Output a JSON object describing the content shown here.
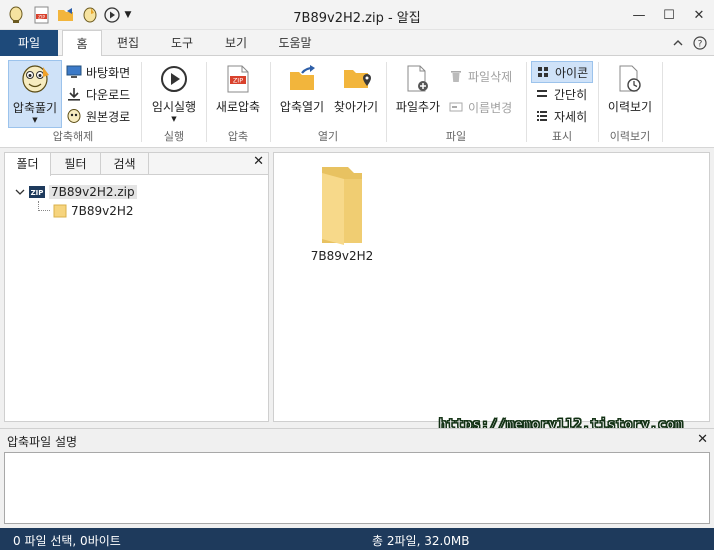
{
  "window": {
    "title": "7B89v2H2.zip - 알집"
  },
  "quick_access": [
    {
      "name": "alzip-logo-icon"
    },
    {
      "name": "zip-file-icon"
    },
    {
      "name": "open-folder-icon"
    },
    {
      "name": "extract-wand-icon"
    },
    {
      "name": "play-icon"
    },
    {
      "name": "dropdown-arrow-icon"
    }
  ],
  "window_controls": {
    "minimize": "—",
    "maximize": "☐",
    "close": "✕"
  },
  "tabs": [
    {
      "label": "파일"
    },
    {
      "label": "홈"
    },
    {
      "label": "편집"
    },
    {
      "label": "도구"
    },
    {
      "label": "보기"
    },
    {
      "label": "도움말"
    }
  ],
  "ribbon": {
    "extract": {
      "label": "압축풀기",
      "desktop": "바탕화면",
      "download": "다운로드",
      "original": "원본경로",
      "group": "압축해제"
    },
    "run": {
      "label": "임시실행",
      "group": "실행"
    },
    "compress": {
      "label": "새로압축",
      "group": "압축"
    },
    "open": {
      "open_label": "압축열기",
      "find_label": "찾아가기",
      "group": "열기"
    },
    "file": {
      "add_label": "파일추가",
      "delete_label": "파일삭제",
      "rename_label": "이름변경",
      "group": "파일"
    },
    "view": {
      "icon_label": "아이콘",
      "simple_label": "간단히",
      "detail_label": "자세히",
      "group": "표시"
    },
    "history": {
      "label": "이력보기",
      "group": "이력보기"
    }
  },
  "left_panel": {
    "tabs": [
      {
        "label": "폴더"
      },
      {
        "label": "필터"
      },
      {
        "label": "검색"
      }
    ],
    "close": "✕",
    "tree": {
      "root": "7B89v2H2.zip",
      "child": "7B89v2H2"
    }
  },
  "main": {
    "items": [
      {
        "name": "7B89v2H2"
      }
    ],
    "watermark": "https://memory112.tistory.com"
  },
  "description": {
    "title": "압축파일 설명",
    "close": "✕"
  },
  "status": {
    "left": "0 파일 선택,  0바이트",
    "right": "총 2파일,  32.0MB"
  },
  "colors": {
    "accent": "#1e4a7a",
    "status_bar": "#1e3a5c",
    "folder": "#f5d27a",
    "selected": "#cfe2f8"
  }
}
